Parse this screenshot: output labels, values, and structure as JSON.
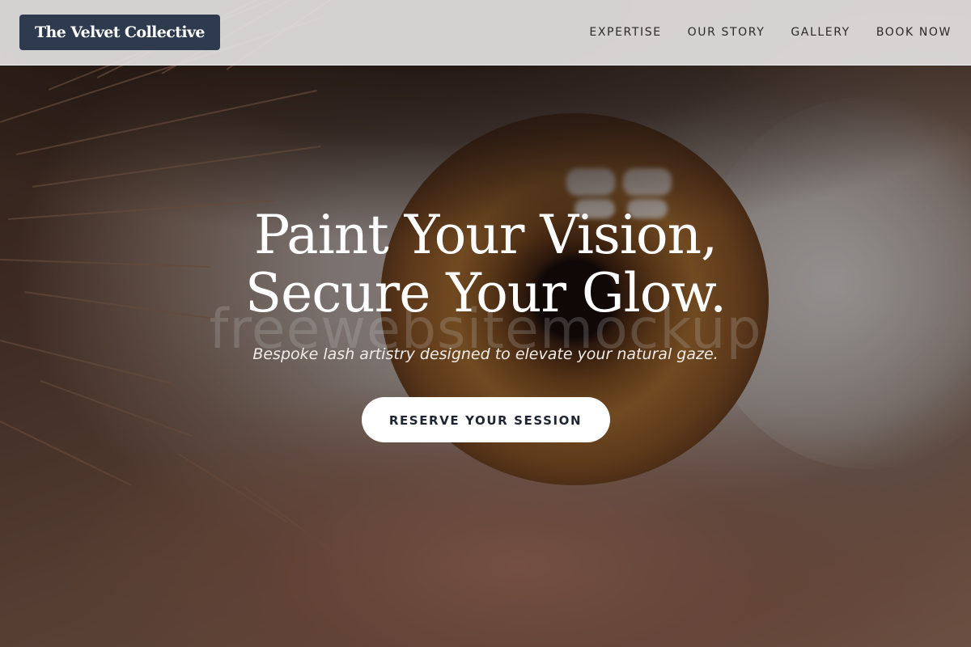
{
  "header": {
    "logo_text": "The Velvet Collective",
    "nav": [
      {
        "label": "EXPERTISE"
      },
      {
        "label": "OUR STORY"
      },
      {
        "label": "GALLERY"
      },
      {
        "label": "BOOK NOW"
      }
    ]
  },
  "hero": {
    "title_line_1": "Paint Your Vision,",
    "title_line_2": "Secure Your Glow.",
    "subtitle": "Bespoke lash artistry designed to elevate your natural gaze.",
    "cta_label": "RESERVE YOUR SESSION",
    "background_image": "close-up brown eye photo",
    "watermark": "freewebsitemockup"
  },
  "colors": {
    "logo_bg": "#2e3a4d",
    "header_bg": "#e2e0e0",
    "cta_bg": "#ffffff",
    "cta_text": "#1e2430",
    "hero_text": "#ffffff"
  }
}
